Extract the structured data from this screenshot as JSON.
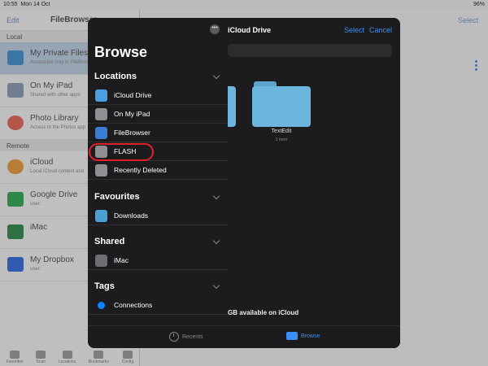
{
  "status": {
    "time": "10:55",
    "date": "Mon 14 Oct",
    "battery": "96%"
  },
  "background": {
    "edit_label": "Edit",
    "app_title": "FileBrowser",
    "select_label": "Select",
    "sections": {
      "local": "Local",
      "remote": "Remote"
    },
    "local_items": [
      {
        "name": "My Private Files",
        "sub": "Accessible only in FileBrowser",
        "color": "#4a90c8"
      },
      {
        "name": "On My iPad",
        "sub": "Shared with other apps",
        "color": "#8a9aad"
      },
      {
        "name": "Photo Library",
        "sub": "Access to the Photos app",
        "color": "#d96b5b"
      }
    ],
    "remote_items": [
      {
        "name": "iCloud",
        "sub": "Local iCloud content and",
        "color": "#e09a45"
      },
      {
        "name": "Google Drive",
        "sub": "user:",
        "color": "#3aa757"
      },
      {
        "name": "iMac",
        "sub": "",
        "color": "#3a8a54"
      },
      {
        "name": "My Dropbox",
        "sub": "user:",
        "color": "#3b6fd6"
      }
    ],
    "tabs": [
      "Favorites",
      "Scan",
      "Locations",
      "Bookmarks",
      "Config"
    ]
  },
  "sheet": {
    "header_title": "iCloud Drive",
    "select_label": "Select",
    "cancel_label": "Cancel",
    "folder_name": "TextEdit",
    "folder_count": "1 item",
    "storage_text": "GB available on iCloud",
    "bottom_tabs": {
      "recents": "Recents",
      "browse": "Browse"
    }
  },
  "browse": {
    "more_glyph": "•••",
    "title": "Browse",
    "sections": {
      "locations": "Locations",
      "favourites": "Favourites",
      "shared": "Shared",
      "tags": "Tags"
    },
    "locations": [
      {
        "label": "iCloud Drive",
        "icon": "cloud-icon",
        "color": "#4a9fe0"
      },
      {
        "label": "On My iPad",
        "icon": "ipad-icon",
        "color": "#8e8e93"
      },
      {
        "label": "FileBrowser",
        "icon": "filebrowser-icon",
        "color": "#3a7bd5"
      },
      {
        "label": "FLASH",
        "icon": "usb-icon",
        "color": "#8e8e93"
      },
      {
        "label": "Recently Deleted",
        "icon": "trash-icon",
        "color": "#8e8e93"
      }
    ],
    "favourites": [
      {
        "label": "Downloads",
        "icon": "downloads-folder-icon",
        "color": "#4aa0d0"
      }
    ],
    "shared": [
      {
        "label": "iMac",
        "icon": "shared-users-icon",
        "color": "#6d6d72"
      }
    ],
    "tags": [
      {
        "label": "Connections",
        "icon": "blue-tag-dot-icon",
        "color": "#0a84ff"
      }
    ]
  }
}
